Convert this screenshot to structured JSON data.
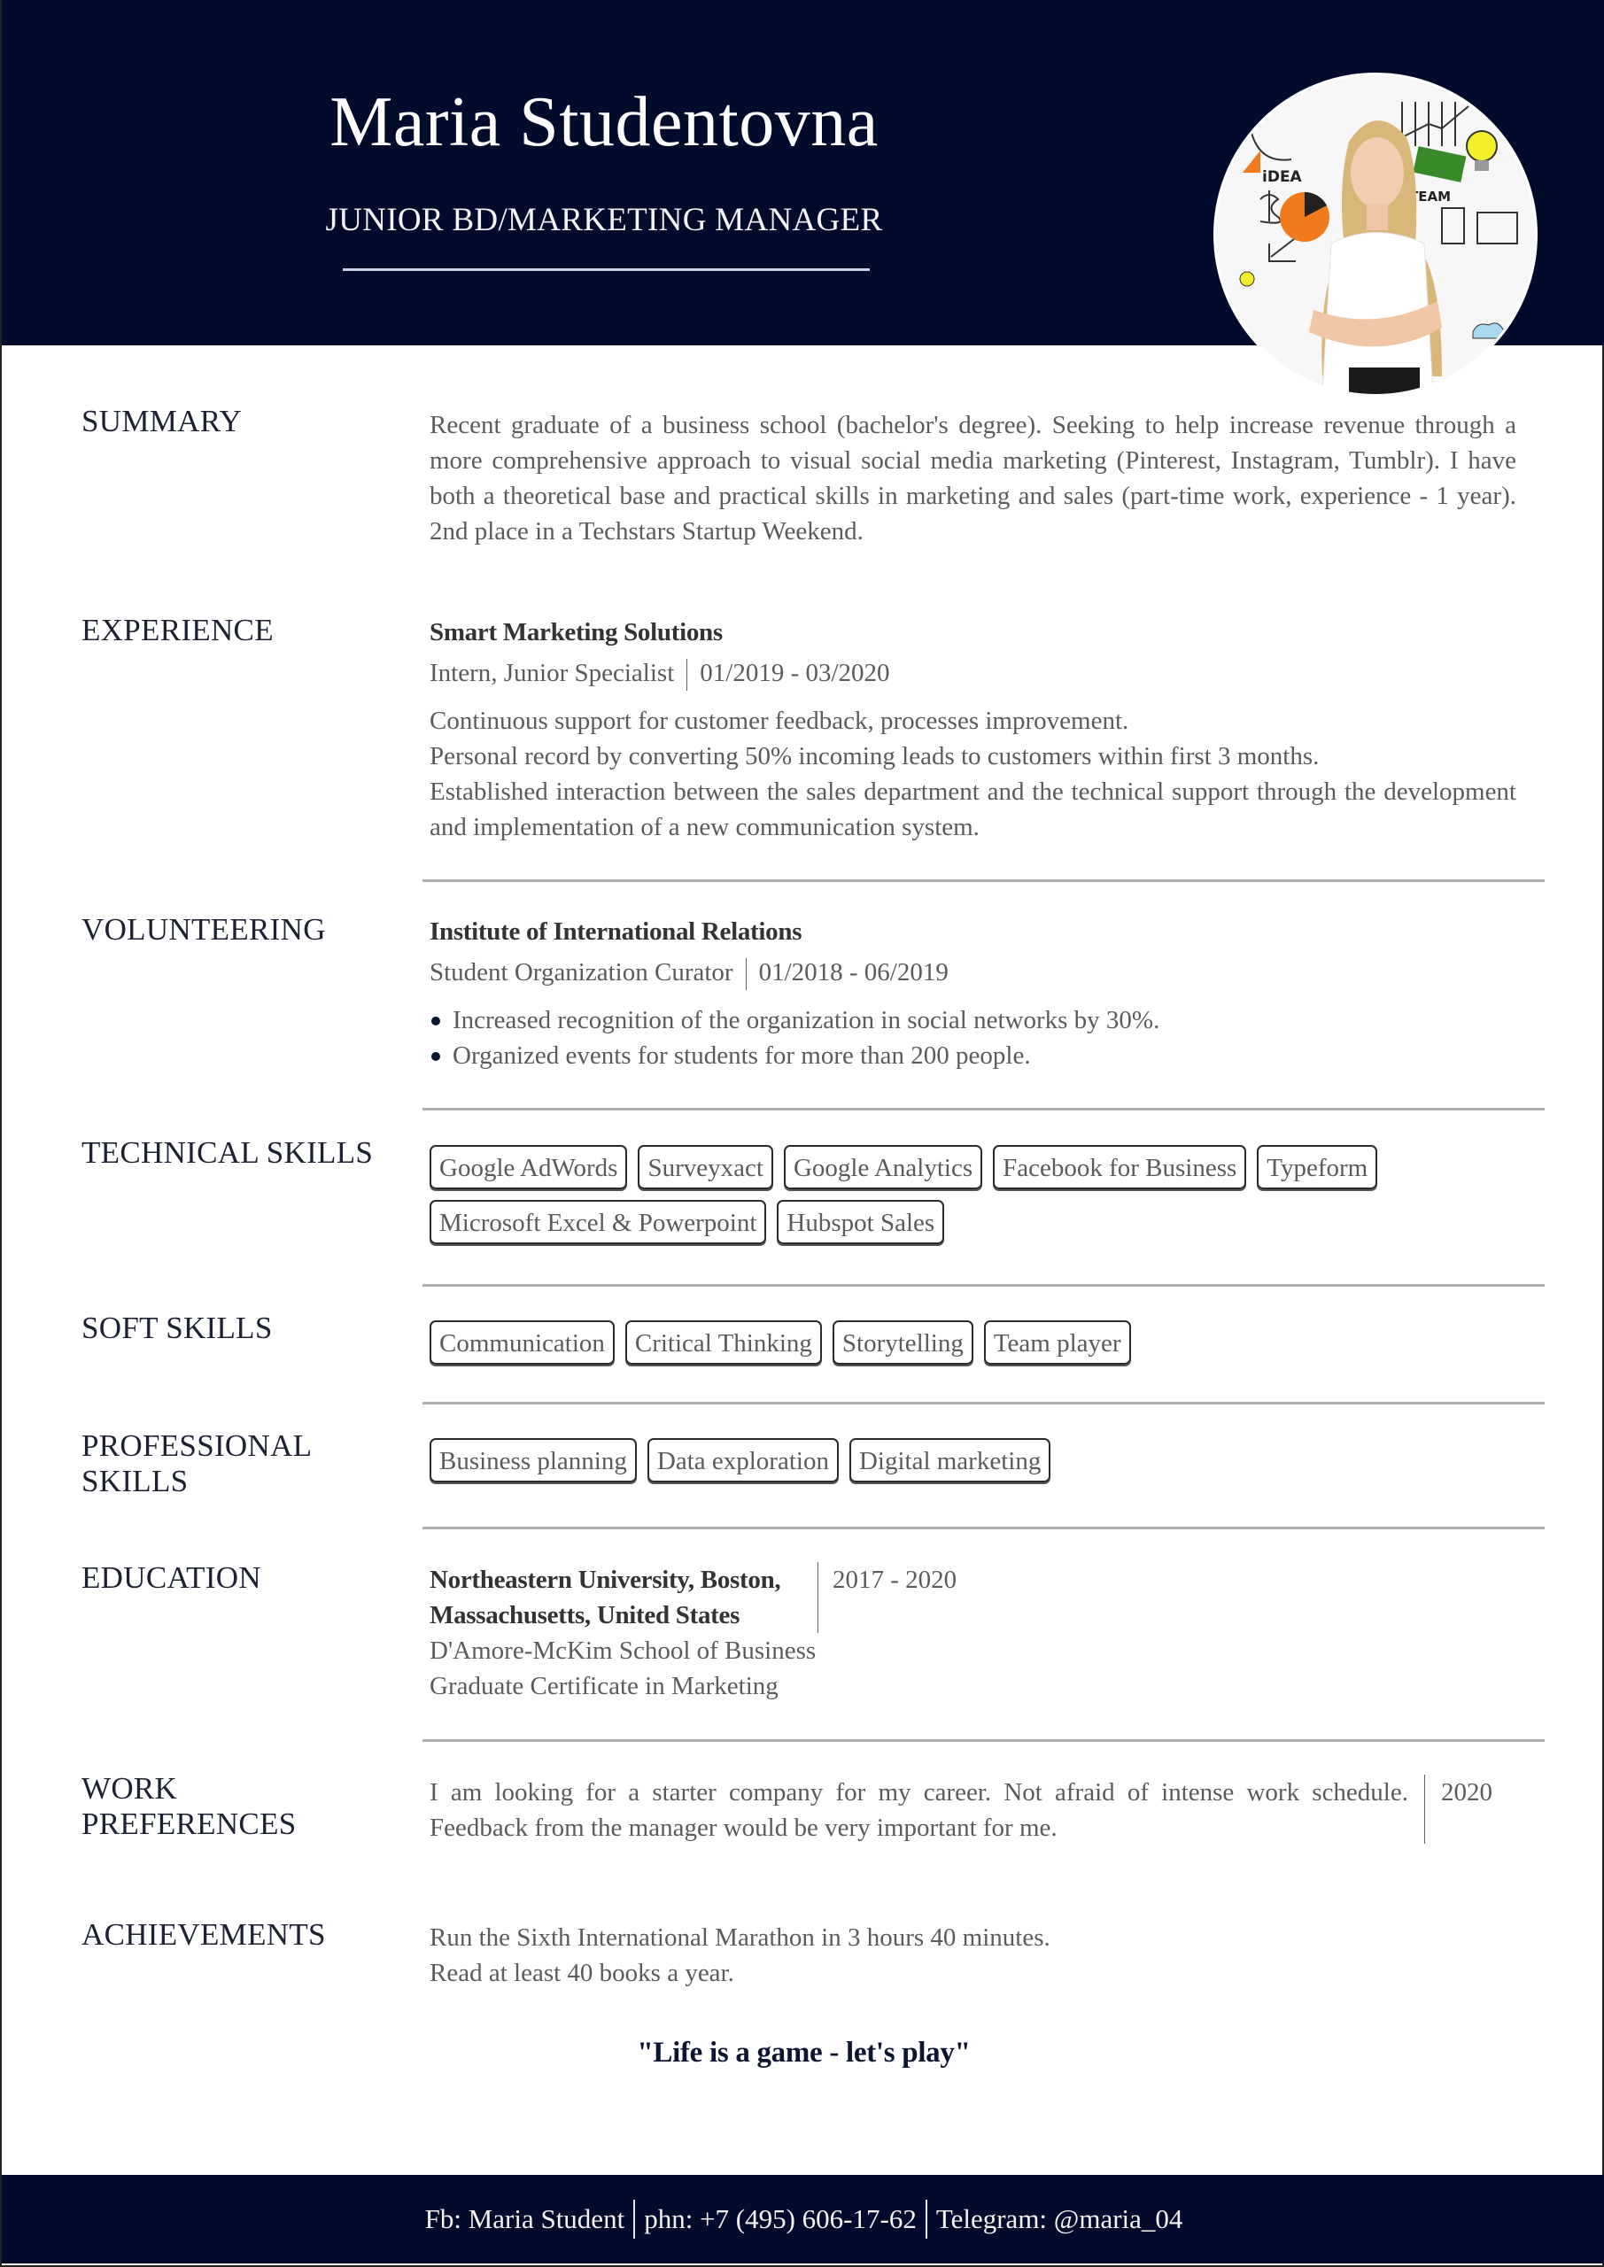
{
  "header": {
    "name": "Maria Studentovna",
    "job_title": "JUNIOR BD/MARKETING MANAGER",
    "photo_alt": "profile-photo"
  },
  "colors": {
    "navy": "#020b2b",
    "text_grey": "#5b5b5b",
    "divider": "#aab0b4"
  },
  "summary": {
    "label": "SUMMARY",
    "text": "Recent graduate of a business school (bachelor's degree). Seeking to help increase revenue through a more comprehensive approach to visual social media marketing (Pinterest, Instagram, Tumblr). I have both a theoretical base and practical skills in marketing and sales (part-time work, experience - 1 year). 2nd place in a Techstars Startup Weekend."
  },
  "experience": {
    "label": "EXPERIENCE",
    "company": "Smart Marketing Solutions",
    "role": "Intern, Junior Specialist",
    "dates": "01/2019 - 03/2020",
    "lines": [
      "Continuous support for customer feedback, processes improvement.",
      "Personal record by converting 50% incoming leads to customers within first 3 months.",
      "Established interaction between the sales department and the technical support through the development and implementation of a new communication system."
    ]
  },
  "volunteering": {
    "label": "VOLUNTEERING",
    "org": "Institute of International Relations",
    "role": "Student Organization Curator",
    "dates": "01/2018 - 06/2019",
    "bullets": [
      "Increased recognition of the organization in social networks by 30%.",
      "Organized events for students for more than 200 people."
    ]
  },
  "technical_skills": {
    "label": "TECHNICAL SKILLS",
    "tags": [
      "Google AdWords",
      "Surveyxact",
      "Google Analytics",
      "Facebook for Business",
      "Typeform",
      "Microsoft Excel & Powerpoint",
      "Hubspot Sales"
    ]
  },
  "soft_skills": {
    "label": "SOFT SKILLS",
    "tags": [
      "Communication",
      "Critical Thinking",
      "Storytelling",
      "Team player"
    ]
  },
  "professional_skills": {
    "label_line1": "PROFESSIONAL",
    "label_line2": "SKILLS",
    "tags": [
      "Business planning",
      "Data exploration",
      "Digital marketing"
    ]
  },
  "education": {
    "label": "EDUCATION",
    "university_line1": "Northeastern University, Boston,",
    "university_line2": "Massachusetts, United States",
    "dates": "2017 - 2020",
    "school": "D'Amore-McKim School of Business",
    "program": "Graduate Certificate in Marketing"
  },
  "work_preferences": {
    "label_line1": "WORK",
    "label_line2": "PREFERENCES",
    "text": "I am looking for a starter company for my career. Not afraid of intense work schedule. Feedback from the manager would be very important for me.",
    "year": "2020"
  },
  "achievements": {
    "label": "ACHIEVEMENTS",
    "lines": [
      "Run the Sixth International Marathon in 3 hours 40 minutes.",
      "Read at least 40 books a year."
    ]
  },
  "quote": "\"Life is a game - let's play\"",
  "footer": {
    "facebook": "Fb: Maria Student",
    "phone": "phn: +7 (495) 606-17-62",
    "telegram": "Telegram: @maria_04"
  }
}
